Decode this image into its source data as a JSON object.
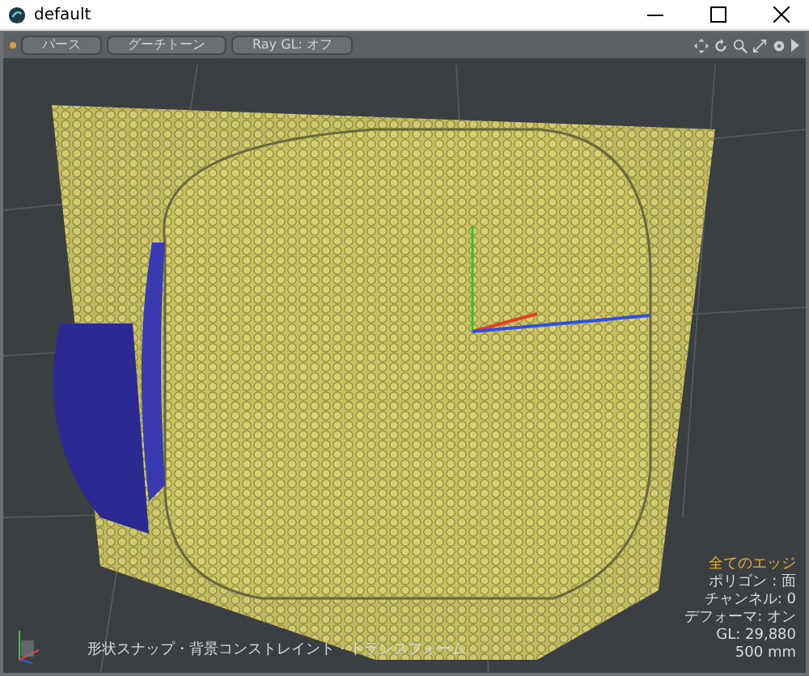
{
  "window": {
    "title": "default"
  },
  "toolbar": {
    "buttons": [
      "パース",
      "グーチトーン",
      "Ray GL: オフ"
    ]
  },
  "viewport": {
    "info_title": "全てのエッジ",
    "info_lines": [
      "ポリゴン : 面",
      "チャンネル: 0",
      "デフォーマ: オン",
      "GL: 29,880",
      "500 mm"
    ],
    "status_text": "形状スナップ・背景コンストレイント・トランスフォーム"
  }
}
